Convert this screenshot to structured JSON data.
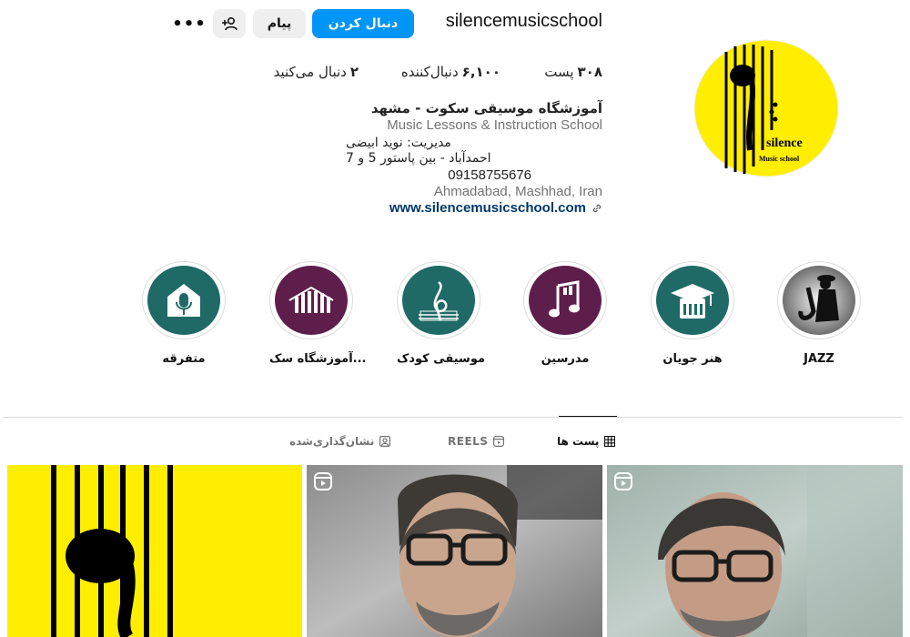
{
  "header": {
    "username": "silencemusicschool",
    "follow_label": "دنبال کردن",
    "message_label": "پیام",
    "more_label": "•••"
  },
  "stats": {
    "posts_count": "۳۰۸",
    "posts_label": "پست",
    "followers_count": "۶,۱۰۰",
    "followers_label": "دنبال‌کننده",
    "following_count": "۲",
    "following_label": "دنبال می‌کنید"
  },
  "bio": {
    "name": "آموزشگاه موسیقی سکوت - مشهد",
    "category": "Music Lessons & Instruction School",
    "line1": "مدیریت: نوید ابیضی",
    "line2": "احمدآباد - بین پاستور 5 و 7",
    "phone": "09158755676",
    "location": "Ahmadabad, Mashhad, Iran",
    "link": "www.silencemusicschool.com"
  },
  "avatar": {
    "brand": "silence",
    "subtitle": "Music school",
    "color": "#ffee00"
  },
  "highlights": [
    {
      "label": "JAZZ",
      "icon": "saxophone-icon"
    },
    {
      "label": "هنر جویان",
      "icon": "graduation-piano-icon"
    },
    {
      "label": "مدرسین",
      "icon": "music-note-icon"
    },
    {
      "label": "موسیقی کودک",
      "icon": "treble-clef-icon"
    },
    {
      "label": "آموزشگاه سک...",
      "icon": "piano-keys-icon"
    },
    {
      "label": "متفرقه",
      "icon": "microphone-house-icon"
    }
  ],
  "tabs": {
    "posts": "پست ها",
    "reels": "REELS",
    "tagged": "نشان‌گذاری‌شده"
  },
  "colors": {
    "accent": "#0095f6",
    "teal": "#1f6a66",
    "maroon": "#5e1e4b",
    "yellow": "#ffee00",
    "link": "#00376b"
  }
}
